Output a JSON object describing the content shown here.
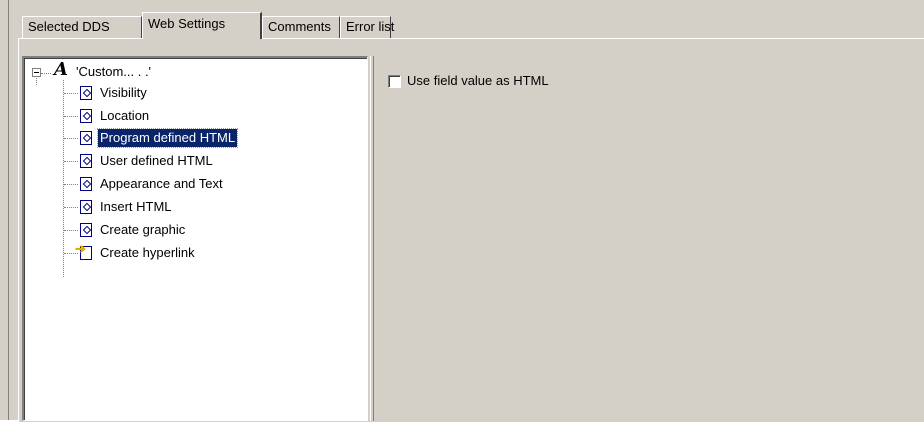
{
  "tabs": [
    {
      "label": "Selected DDS"
    },
    {
      "label": "Web Settings"
    },
    {
      "label": "Comments"
    },
    {
      "label": "Error list"
    }
  ],
  "active_tab": "Web Settings",
  "tree": {
    "root": {
      "label": "'Custom... . .'",
      "icon": "font-icon"
    },
    "items": [
      {
        "label": "Visibility",
        "icon": "property-page-icon"
      },
      {
        "label": "Location",
        "icon": "property-page-icon"
      },
      {
        "label": "Program defined HTML",
        "icon": "property-page-icon",
        "selected": true
      },
      {
        "label": "User defined HTML",
        "icon": "property-page-icon"
      },
      {
        "label": "Appearance and Text",
        "icon": "property-page-icon"
      },
      {
        "label": "Insert HTML",
        "icon": "property-page-icon"
      },
      {
        "label": "Create graphic",
        "icon": "property-page-icon"
      },
      {
        "label": "Create hyperlink",
        "icon": "hyperlink-page-icon"
      }
    ]
  },
  "options": {
    "use_field_value_as_html": {
      "label": "Use field value as HTML",
      "checked": false
    }
  },
  "colors": {
    "face": "#d4d0c8",
    "selection": "#0a246a"
  }
}
